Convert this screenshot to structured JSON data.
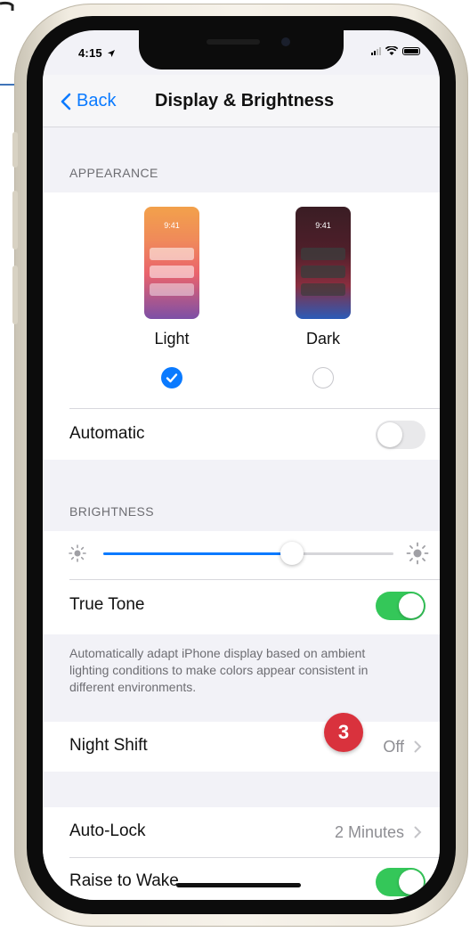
{
  "status_bar": {
    "time": "4:15"
  },
  "nav": {
    "back_label": "Back",
    "title": "Display & Brightness"
  },
  "appearance": {
    "header": "APPEARANCE",
    "options": [
      {
        "label": "Light",
        "preview_time": "9:41",
        "selected": true
      },
      {
        "label": "Dark",
        "preview_time": "9:41",
        "selected": false
      }
    ],
    "automatic": {
      "label": "Automatic",
      "enabled": false
    }
  },
  "brightness": {
    "header": "BRIGHTNESS",
    "level": 0.65,
    "true_tone": {
      "label": "True Tone",
      "enabled": true
    },
    "footnote": "Automatically adapt iPhone display based on ambient lighting conditions to make colors appear consistent in different environments."
  },
  "night_shift": {
    "label": "Night Shift",
    "value": "Off"
  },
  "step_badge": "3",
  "auto_lock": {
    "label": "Auto-Lock",
    "value": "2 Minutes"
  },
  "raise_to_wake": {
    "label": "Raise to Wake",
    "enabled": true
  },
  "colors": {
    "accent": "#0a7aff",
    "toggle_on": "#34c759",
    "badge": "#d9323d"
  }
}
